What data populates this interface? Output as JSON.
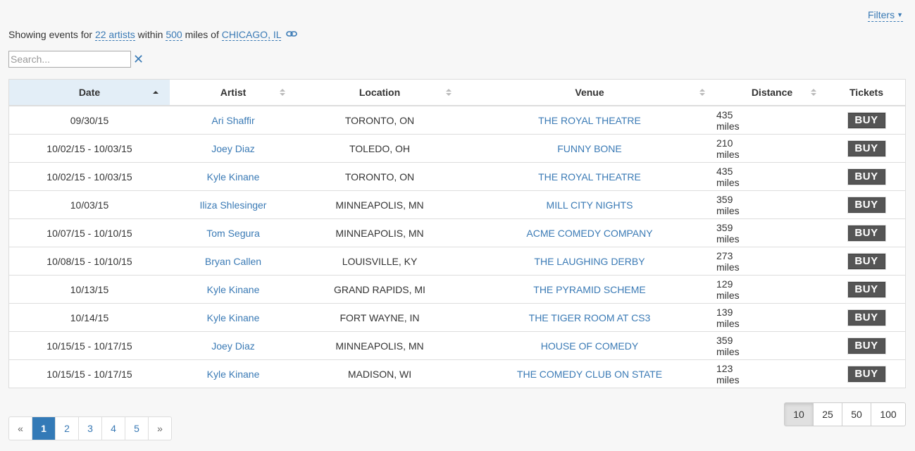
{
  "filters": {
    "label": "Filters"
  },
  "summary": {
    "prefix": "Showing events for",
    "artists_link": "22 artists",
    "within": "within",
    "miles_link": "500",
    "miles_of": "miles of",
    "location_link": "CHICAGO, IL"
  },
  "search": {
    "placeholder": "Search...",
    "value": ""
  },
  "table": {
    "columns": [
      "Date",
      "Artist",
      "Location",
      "Venue",
      "Distance",
      "Tickets"
    ],
    "sorted_column": "Date",
    "buy_label": "BUY",
    "rows": [
      {
        "date": "09/30/15",
        "artist": "Ari Shaffir",
        "location": "TORONTO, ON",
        "venue": "THE ROYAL THEATRE",
        "distance": "435 miles"
      },
      {
        "date": "10/02/15 - 10/03/15",
        "artist": "Joey Diaz",
        "location": "TOLEDO, OH",
        "venue": "FUNNY BONE",
        "distance": "210 miles"
      },
      {
        "date": "10/02/15 - 10/03/15",
        "artist": "Kyle Kinane",
        "location": "TORONTO, ON",
        "venue": "THE ROYAL THEATRE",
        "distance": "435 miles"
      },
      {
        "date": "10/03/15",
        "artist": "Iliza Shlesinger",
        "location": "MINNEAPOLIS, MN",
        "venue": "MILL CITY NIGHTS",
        "distance": "359 miles"
      },
      {
        "date": "10/07/15 - 10/10/15",
        "artist": "Tom Segura",
        "location": "MINNEAPOLIS, MN",
        "venue": "ACME COMEDY COMPANY",
        "distance": "359 miles"
      },
      {
        "date": "10/08/15 - 10/10/15",
        "artist": "Bryan Callen",
        "location": "LOUISVILLE, KY",
        "venue": "THE LAUGHING DERBY",
        "distance": "273 miles"
      },
      {
        "date": "10/13/15",
        "artist": "Kyle Kinane",
        "location": "GRAND RAPIDS, MI",
        "venue": "THE PYRAMID SCHEME",
        "distance": "129 miles"
      },
      {
        "date": "10/14/15",
        "artist": "Kyle Kinane",
        "location": "FORT WAYNE, IN",
        "venue": "THE TIGER ROOM AT CS3",
        "distance": "139 miles"
      },
      {
        "date": "10/15/15 - 10/17/15",
        "artist": "Joey Diaz",
        "location": "MINNEAPOLIS, MN",
        "venue": "HOUSE OF COMEDY",
        "distance": "359 miles"
      },
      {
        "date": "10/15/15 - 10/17/15",
        "artist": "Kyle Kinane",
        "location": "MADISON, WI",
        "venue": "THE COMEDY CLUB ON STATE",
        "distance": "123 miles"
      }
    ]
  },
  "pagination": {
    "prev": "«",
    "pages": [
      "1",
      "2",
      "3",
      "4",
      "5"
    ],
    "next": "»",
    "current": "1"
  },
  "page_size": {
    "options": [
      "10",
      "25",
      "50",
      "100"
    ],
    "selected": "10"
  },
  "colors": {
    "link": "#3a7ab5",
    "active_page": "#337ab7",
    "sorted_header": "#e3eef7",
    "buy_button": "#555555"
  }
}
